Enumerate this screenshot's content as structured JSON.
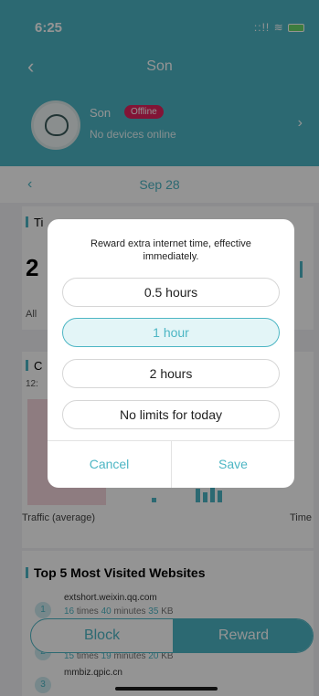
{
  "status_bar": {
    "time": "6:25",
    "signal": "::!! ≋"
  },
  "nav": {
    "back_icon": "chevron-left-icon",
    "title": "Son"
  },
  "profile": {
    "name": "Son",
    "status_badge": "Offline",
    "subtitle": "No devices online",
    "chevron_icon": "chevron-right-icon"
  },
  "date": {
    "label": "Sep 28",
    "prev_icon": "chevron-left-icon"
  },
  "card_time": {
    "title": "Ti",
    "big_value": "2",
    "small": "All"
  },
  "card_chart": {
    "title": "C",
    "small": "12:",
    "x_left": "Traffic (average)",
    "x_right": "Time"
  },
  "sites": {
    "title": "Top 5 Most Visited Websites",
    "items": [
      {
        "rank": "1",
        "url": "extshort.weixin.qq.com",
        "times": "16",
        "times_label": "times",
        "minutes": "40",
        "minutes_label": "minutes",
        "kb": "35",
        "kb_label": "KB"
      },
      {
        "rank": "2",
        "url": "",
        "times": "15",
        "times_label": "times",
        "minutes": "19",
        "minutes_label": "minutes",
        "kb": "20",
        "kb_label": "KB"
      },
      {
        "rank": "3",
        "url": "mmbiz.qpic.cn"
      }
    ]
  },
  "bottom_actions": {
    "block": "Block",
    "reward": "Reward"
  },
  "dialog": {
    "message": "Reward extra internet time, effective immediately.",
    "options": [
      "0.5 hours",
      "1 hour",
      "2 hours",
      "No limits for today"
    ],
    "selected_index": 1,
    "cancel": "Cancel",
    "save": "Save"
  },
  "colors": {
    "accent": "#4db6c4",
    "offline": "#e0245e",
    "selected_bg": "#e3f5f7"
  }
}
